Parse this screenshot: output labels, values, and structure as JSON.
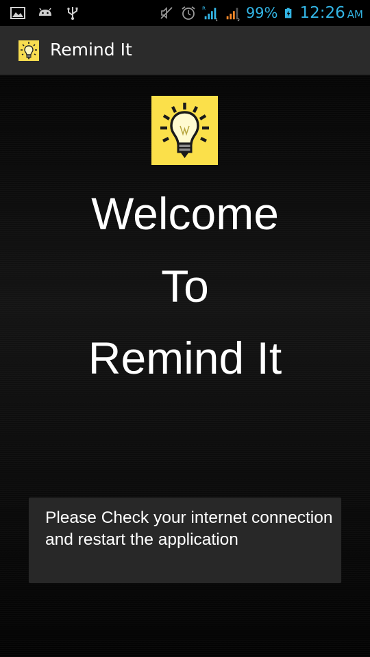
{
  "status_bar": {
    "battery_percent": "99%",
    "time": "12:26",
    "ampm": "AM",
    "icons": [
      "gallery-icon",
      "android-icon",
      "usb-icon",
      "mute-icon",
      "alarm-icon",
      "signal-icon-1",
      "signal-icon-2",
      "battery-icon"
    ],
    "accent_color": "#33b5e5"
  },
  "action_bar": {
    "title": "Remind It",
    "icon": "lightbulb-icon"
  },
  "main": {
    "logo": "lightbulb-icon",
    "welcome_lines": [
      "Welcome",
      "To",
      "Remind It"
    ]
  },
  "toast": {
    "message": "Please Check your internet connection and restart the application"
  }
}
